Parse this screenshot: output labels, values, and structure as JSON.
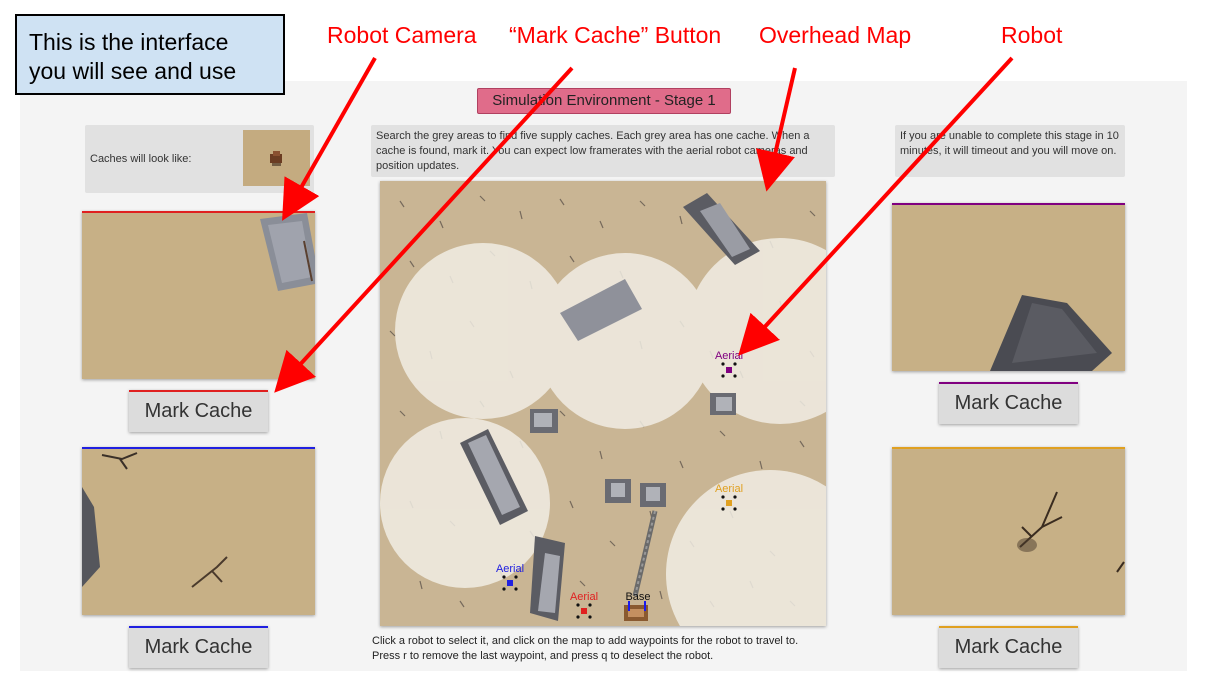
{
  "callout": {
    "line1": "This is the interface",
    "line2": "you will see and use"
  },
  "annotations": {
    "robot_camera": "Robot Camera",
    "mark_cache_button": "“Mark Cache” Button",
    "overhead_map": "Overhead Map",
    "robot": "Robot"
  },
  "stage_title": "Simulation Environment - Stage 1",
  "cache_example": {
    "label": "Caches will look like:"
  },
  "instructions": "Search the grey areas to find five supply caches. Each grey area has one cache. When a cache is found, mark it. You can expect low framerates with the aerial robot cameras and position updates.",
  "timeout_note": "If you are unable to complete this stage in 10 minutes, it will timeout and you will move on.",
  "cameras": [
    {
      "id": "red",
      "color": "#e02020",
      "button_label": "Mark Cache"
    },
    {
      "id": "blue",
      "color": "#2020e0",
      "button_label": "Mark Cache"
    },
    {
      "id": "purple",
      "color": "#800080",
      "button_label": "Mark Cache"
    },
    {
      "id": "orange",
      "color": "#e0a020",
      "button_label": "Mark Cache"
    }
  ],
  "map": {
    "robots": [
      {
        "label": "Aerial",
        "color": "#800080"
      },
      {
        "label": "Aerial",
        "color": "#e0a020"
      },
      {
        "label": "Aerial",
        "color": "#2020e0"
      },
      {
        "label": "Aerial",
        "color": "#e02020"
      }
    ],
    "base_label": "Base"
  },
  "bottom_instructions": {
    "line1": "Click a robot to select it, and click on the map to add waypoints for the robot to travel to.",
    "line2": "Press r to remove the last waypoint, and press q to deselect the robot."
  },
  "colors": {
    "annotation": "#ff0000",
    "stage_title_bg": "#e06c8a",
    "callout_bg": "#cfe2f3"
  }
}
